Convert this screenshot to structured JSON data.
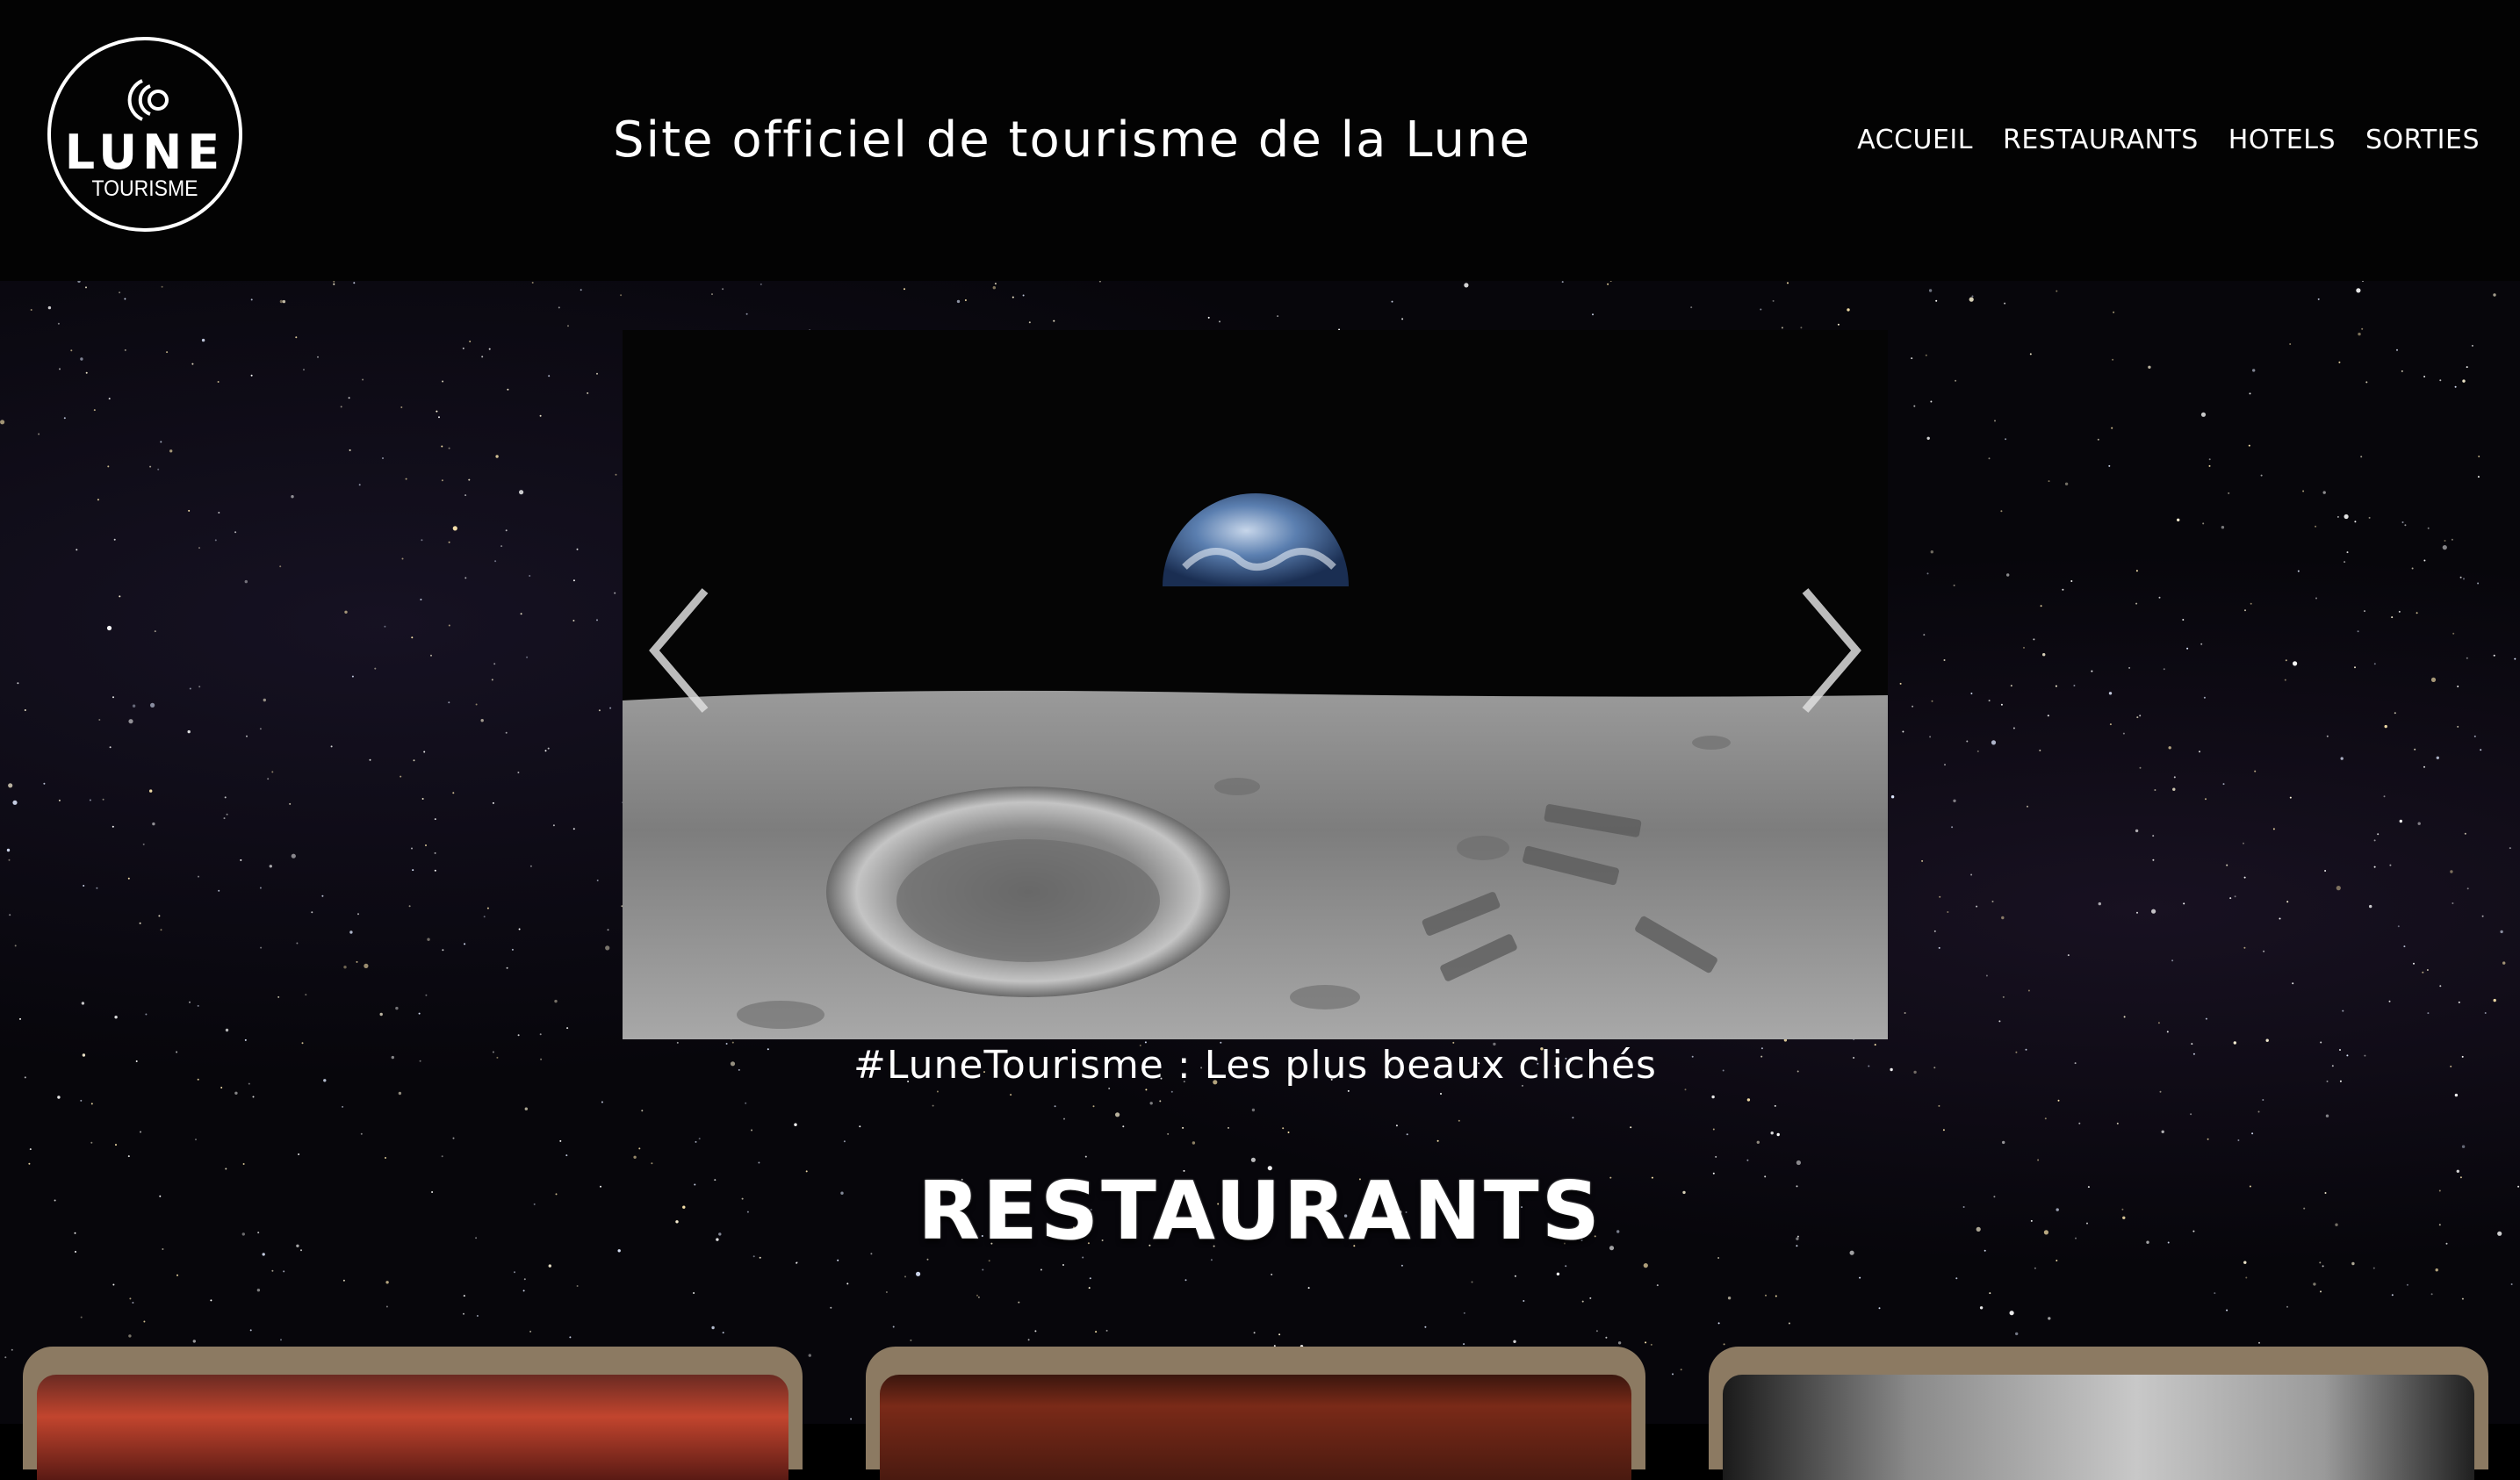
{
  "header": {
    "logo": {
      "brand": "LUNE",
      "subtitle": "TOURISME"
    },
    "site_title": "Site officiel de tourisme de la Lune",
    "nav": [
      {
        "label": "ACCUEIL"
      },
      {
        "label": "RESTAURANTS"
      },
      {
        "label": "HOTELS"
      },
      {
        "label": "SORTIES"
      }
    ]
  },
  "carousel": {
    "caption": "#LuneTourisme : Les plus beaux clichés",
    "prev_icon": "chevron-left-icon",
    "next_icon": "chevron-right-icon"
  },
  "restaurants": {
    "title": "RESTAURANTS",
    "cards": [
      {
        "name": "restaurant-card-1"
      },
      {
        "name": "restaurant-card-2"
      },
      {
        "name": "restaurant-card-3"
      }
    ]
  },
  "colors": {
    "background": "#000000",
    "card_frame": "#8c7a62",
    "text": "#ffffff"
  }
}
